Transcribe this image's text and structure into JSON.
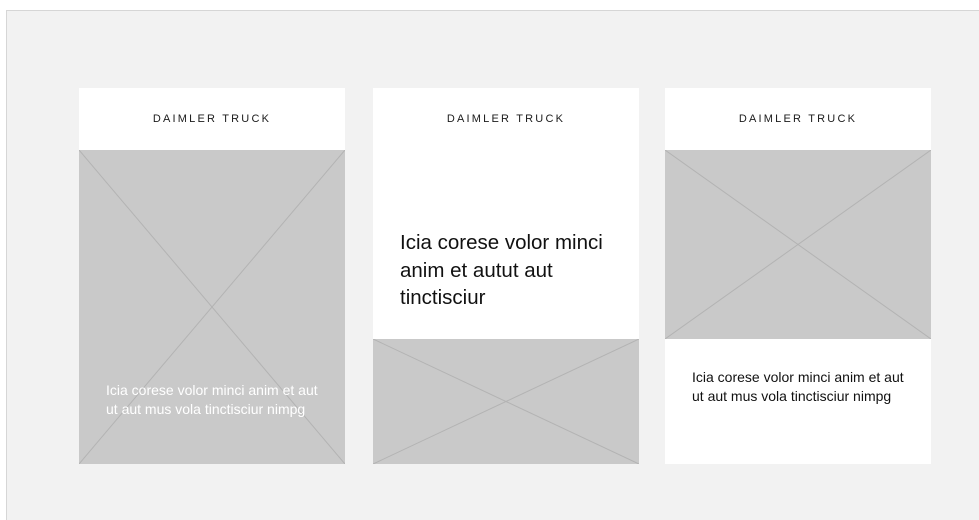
{
  "cards": [
    {
      "brand": "DAIMLER TRUCK",
      "image": "image-placeholder",
      "text": "Icia corese volor minci anim et aut ut aut mus vola tinctisciur nimpg"
    },
    {
      "brand": "DAIMLER TRUCK",
      "text": "Icia corese volor minci anim et autut aut tinctisciur",
      "image": "image-placeholder"
    },
    {
      "brand": "DAIMLER TRUCK",
      "image": "image-placeholder",
      "text": "Icia corese volor minci anim et aut ut aut mus vola tinctisciur nimpg"
    }
  ],
  "colors": {
    "canvas": "#f2f2f2",
    "card": "#ffffff",
    "placeholder": "#c9c9c9",
    "placeholder_lines": "#b3b3b3",
    "text_dark": "#111111",
    "text_light": "#ffffff"
  }
}
